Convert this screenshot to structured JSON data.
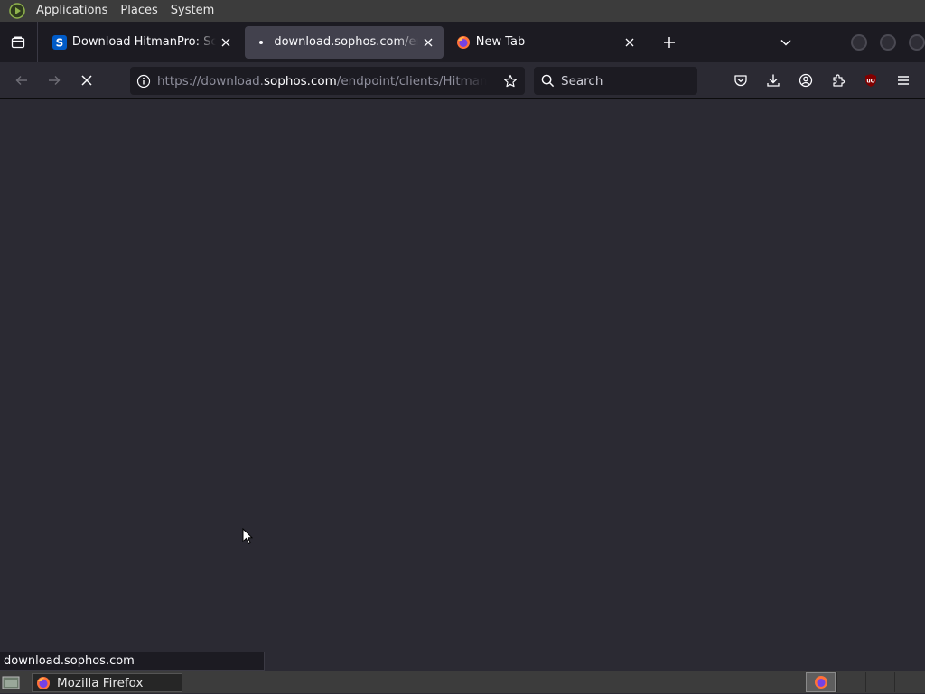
{
  "top_panel": {
    "menus": [
      "Applications",
      "Places",
      "System"
    ],
    "logo_icon": "gnome-foot-logo"
  },
  "tabs": [
    {
      "title": "Download HitmanPro: Scan",
      "favicon": "sophos-s-icon",
      "selected": false
    },
    {
      "title": "download.sophos.com/endp",
      "favicon": "loading-dot",
      "selected": true
    },
    {
      "title": "New Tab",
      "favicon": "firefox-icon",
      "selected": false
    }
  ],
  "navbar": {
    "url_prefix": "https://download.",
    "url_domain": "sophos.com",
    "url_suffix": "/endpoint/clients/HitmanPro",
    "search_placeholder": "Search"
  },
  "status": {
    "text": "download.sophos.com"
  },
  "taskbar": {
    "window_title": "Mozilla Firefox"
  },
  "colors": {
    "tab_strip_bg": "#1c1b22",
    "toolbar_bg": "#2b2a33",
    "selected_tab_bg": "#42414d",
    "panel_bg": "#3c3c3c",
    "ublock_red": "#800000",
    "sophos_blue": "#005bc8"
  }
}
